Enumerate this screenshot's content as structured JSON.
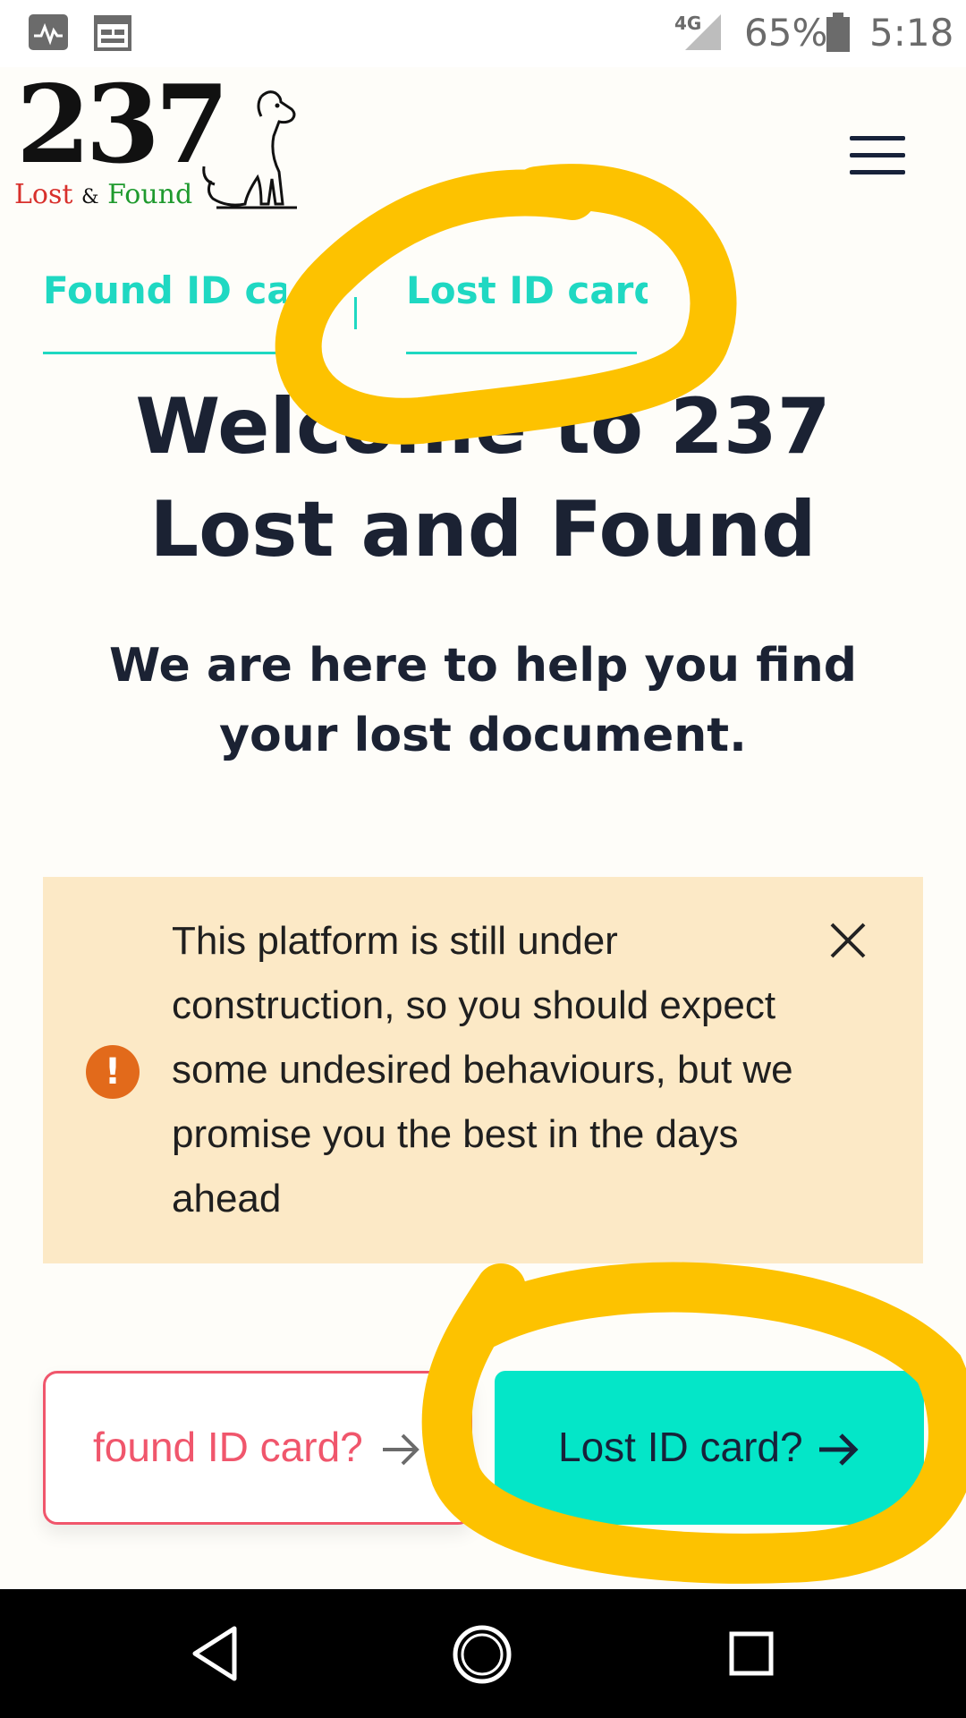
{
  "status_bar": {
    "network": "4G",
    "battery": "65%",
    "time": "5:18",
    "icons": [
      "activity-icon",
      "calendar-icon",
      "signal-icon",
      "battery-icon"
    ]
  },
  "header": {
    "logo_number": "237",
    "logo_lost": "Lost",
    "logo_amp": "&",
    "logo_found": "Found",
    "logo_icon": "dog-icon",
    "menu_icon": "hamburger-menu-icon"
  },
  "tabs": [
    {
      "label": "Found ID card"
    },
    {
      "label": "Lost ID card"
    }
  ],
  "main": {
    "title": "Welcome to 237 Lost and Found",
    "subtitle": "We are here to help you find your lost document."
  },
  "alert": {
    "icon": "exclamation-icon",
    "message": "This platform is still under construction, so you should expect some undesired behaviours, but we promise you the best in the days ahead",
    "close_icon": "close-icon"
  },
  "buttons": {
    "found_label": "found ID card?",
    "lost_label": "Lost ID card?",
    "arrow_icon": "arrow-right-icon"
  },
  "nav_bar": {
    "back_icon": "back-triangle-icon",
    "home_icon": "home-circle-icon",
    "recents_icon": "recents-square-icon"
  },
  "colors": {
    "accent_teal": "#04e6c8",
    "tab_teal": "#1fd8c2",
    "found_pink": "#f0566c",
    "alert_bg": "#fce9c6",
    "alert_icon": "#e26a1b",
    "highlight_yellow": "#fdc200",
    "text_dark": "#1b2233"
  }
}
